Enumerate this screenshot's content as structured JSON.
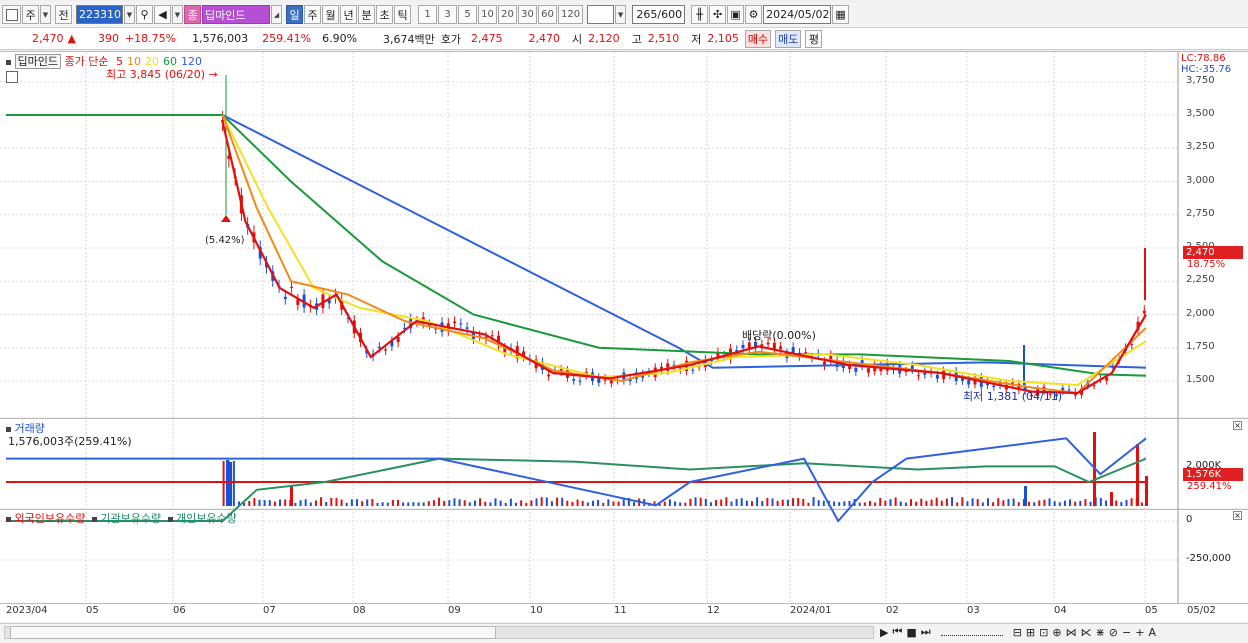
{
  "toolbar": {
    "market_label": "주",
    "prev_label": "전",
    "stock_code": "223310",
    "stock_badge": "종",
    "stock_name": "딥마인드",
    "periods": [
      "일",
      "주",
      "월",
      "년",
      "분",
      "초",
      "틱"
    ],
    "active_period": "일",
    "minutes": [
      "1",
      "3",
      "5",
      "10",
      "20",
      "30",
      "60",
      "120"
    ],
    "count": "265",
    "count_total": "/600",
    "date": "2024/05/02"
  },
  "quote": {
    "price": "2,470",
    "change": "390",
    "change_rate": "+18.75%",
    "volume": "1,576,003",
    "volume_rate": "259.41%",
    "turnover": "6.90%",
    "amount": "3,674백만",
    "ask_label": "호가",
    "ask1": "2,475",
    "ask2": "2,470",
    "open_label": "시",
    "open": "2,120",
    "high_label": "고",
    "high": "2,510",
    "low_label": "저",
    "low": "2,105",
    "buy_label": "매수",
    "sell_label": "매도",
    "avg_label": "평"
  },
  "price_panel": {
    "name_tag": "딥마인드",
    "ma_label": "종가 단순",
    "ma_periods": [
      "5",
      "10",
      "20",
      "60",
      "120"
    ],
    "high_note": "최고 3,845 (06/20)",
    "low_note": "최저 1,381 (04/11)",
    "lc": "LC:78.86",
    "hc": "HC:-35.76",
    "pct_note": "(5.42%)",
    "dividend_note": "배당락(0.00%)",
    "price_tag": "2,470",
    "rate_tag": "18.75%",
    "yticks": [
      "3,750",
      "3,500",
      "3,250",
      "3,000",
      "2,750",
      "2,500",
      "2,250",
      "2,000",
      "1,750",
      "1,500"
    ]
  },
  "volume_panel": {
    "title": "거래량",
    "value": "1,576,003주(259.41%)",
    "tick": "2,000K",
    "tag": "1,576K",
    "rate_tag": "259.41%"
  },
  "holding_panel": {
    "foreign": "외국인보유수량",
    "institution": "기관보유수량",
    "individual": "개인보유수량",
    "ticks": [
      "0",
      "-250,000"
    ]
  },
  "xaxis": [
    "2023/04",
    "05",
    "06",
    "07",
    "08",
    "09",
    "10",
    "11",
    "12",
    "2024/01",
    "02",
    "03",
    "04",
    "05",
    "05/02"
  ],
  "colors": {
    "ma5": "#e01010",
    "ma10": "#f08a1a",
    "ma20": "#f5e020",
    "ma60": "#1a9a3a",
    "ma120": "#3060e0",
    "up": "#e01010",
    "down": "#1a4fd6"
  },
  "chart_data": {
    "type": "line",
    "price_series": {
      "ma120": [
        [
          0,
          3500
        ],
        [
          0.19,
          3500
        ],
        [
          0.59,
          1750
        ],
        [
          0.62,
          1600
        ],
        [
          0.86,
          1640
        ],
        [
          1,
          1600
        ]
      ],
      "ma60": [
        [
          0,
          3500
        ],
        [
          0.19,
          3500
        ],
        [
          0.25,
          3000
        ],
        [
          0.33,
          2400
        ],
        [
          0.41,
          2000
        ],
        [
          0.52,
          1750
        ],
        [
          0.66,
          1700
        ],
        [
          0.75,
          1700
        ],
        [
          0.88,
          1650
        ],
        [
          0.96,
          1550
        ],
        [
          1,
          1540
        ]
      ],
      "ma20": [
        [
          0.19,
          3500
        ],
        [
          0.23,
          2800
        ],
        [
          0.27,
          2200
        ],
        [
          0.31,
          2050
        ],
        [
          0.37,
          1950
        ],
        [
          0.44,
          1700
        ],
        [
          0.52,
          1530
        ],
        [
          0.58,
          1560
        ],
        [
          0.64,
          1680
        ],
        [
          0.72,
          1700
        ],
        [
          0.8,
          1620
        ],
        [
          0.88,
          1500
        ],
        [
          0.94,
          1470
        ],
        [
          1,
          1800
        ]
      ],
      "ma10": [
        [
          0.19,
          3500
        ],
        [
          0.22,
          2800
        ],
        [
          0.25,
          2250
        ],
        [
          0.3,
          2150
        ],
        [
          0.35,
          1950
        ],
        [
          0.42,
          1820
        ],
        [
          0.48,
          1580
        ],
        [
          0.54,
          1500
        ],
        [
          0.6,
          1640
        ],
        [
          0.66,
          1720
        ],
        [
          0.74,
          1640
        ],
        [
          0.82,
          1560
        ],
        [
          0.9,
          1450
        ],
        [
          0.94,
          1410
        ],
        [
          1,
          1900
        ]
      ],
      "ma5": [
        [
          0.19,
          3450
        ],
        [
          0.21,
          2700
        ],
        [
          0.24,
          2200
        ],
        [
          0.27,
          2050
        ],
        [
          0.29,
          2150
        ],
        [
          0.32,
          1680
        ],
        [
          0.36,
          1950
        ],
        [
          0.42,
          1850
        ],
        [
          0.48,
          1560
        ],
        [
          0.53,
          1520
        ],
        [
          0.6,
          1620
        ],
        [
          0.66,
          1760
        ],
        [
          0.74,
          1620
        ],
        [
          0.82,
          1560
        ],
        [
          0.9,
          1420
        ],
        [
          0.94,
          1410
        ],
        [
          0.97,
          1560
        ],
        [
          1,
          2000
        ]
      ]
    },
    "holding_series": {
      "institution": [
        [
          0,
          0
        ],
        [
          0.19,
          0
        ],
        [
          0.22,
          -200000
        ],
        [
          0.28,
          -250000
        ],
        [
          0.38,
          -400000
        ],
        [
          0.5,
          -380000
        ],
        [
          0.6,
          -330000
        ],
        [
          0.7,
          -370000
        ],
        [
          0.8,
          -330000
        ],
        [
          0.86,
          -350000
        ],
        [
          0.92,
          -350000
        ],
        [
          0.95,
          -250000
        ],
        [
          1,
          -400000
        ]
      ],
      "foreign": [
        [
          0,
          -400000
        ],
        [
          0.38,
          -400000
        ],
        [
          0.57,
          -100000
        ],
        [
          0.6,
          -250000
        ],
        [
          0.7,
          -400000
        ],
        [
          0.73,
          0
        ],
        [
          0.76,
          -250000
        ],
        [
          0.79,
          -400000
        ],
        [
          0.93,
          -530000
        ],
        [
          0.96,
          -300000
        ],
        [
          1,
          -530000
        ]
      ],
      "individual_line": -250000
    }
  }
}
